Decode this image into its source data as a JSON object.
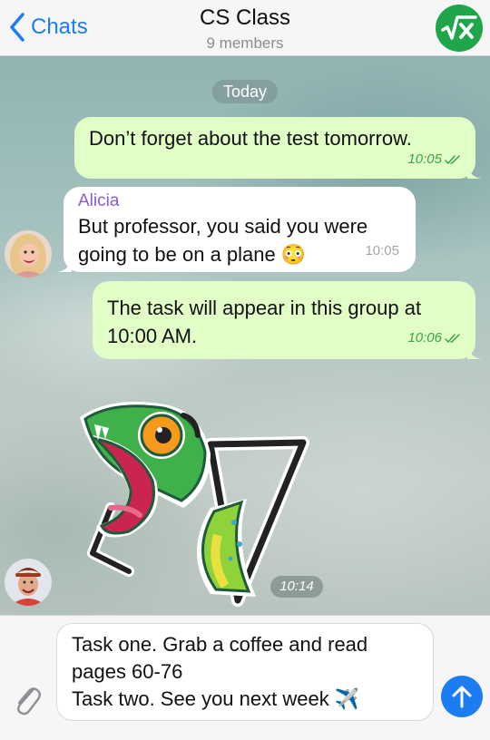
{
  "header": {
    "back_label": "Chats",
    "title": "CS Class",
    "subtitle": "9 members",
    "group_avatar_symbol": "√x",
    "group_avatar_color": "#1fa64a"
  },
  "chat": {
    "date_separator": "Today",
    "messages": [
      {
        "direction": "out",
        "text": "Don’t forget about the test tomorrow.",
        "time": "10:05",
        "status": "read"
      },
      {
        "direction": "in",
        "sender": "Alicia",
        "text_line1": "But professor, you said you were",
        "text_line2": "going to be on a plane 😳",
        "time": "10:05"
      },
      {
        "direction": "out",
        "text_line1": "The task will appear in this group at",
        "text_line2": "10:00 AM.",
        "time": "10:06",
        "status": "read"
      },
      {
        "direction": "in",
        "type": "sticker",
        "sticker_icon": "chameleon-sticker",
        "time": "10:14"
      }
    ]
  },
  "composer": {
    "text": "Task one. Grab a coffee and read\npages 60-76\nTask two. See you next week ✈️",
    "attach_icon": "paperclip-icon",
    "send_icon": "arrow-up-icon"
  },
  "colors": {
    "accent": "#1c7df2",
    "outgoing_bubble": "#e1fec6",
    "incoming_bubble": "#ffffff",
    "sender_name": "#8d59cf",
    "read_check": "#3aa545"
  }
}
